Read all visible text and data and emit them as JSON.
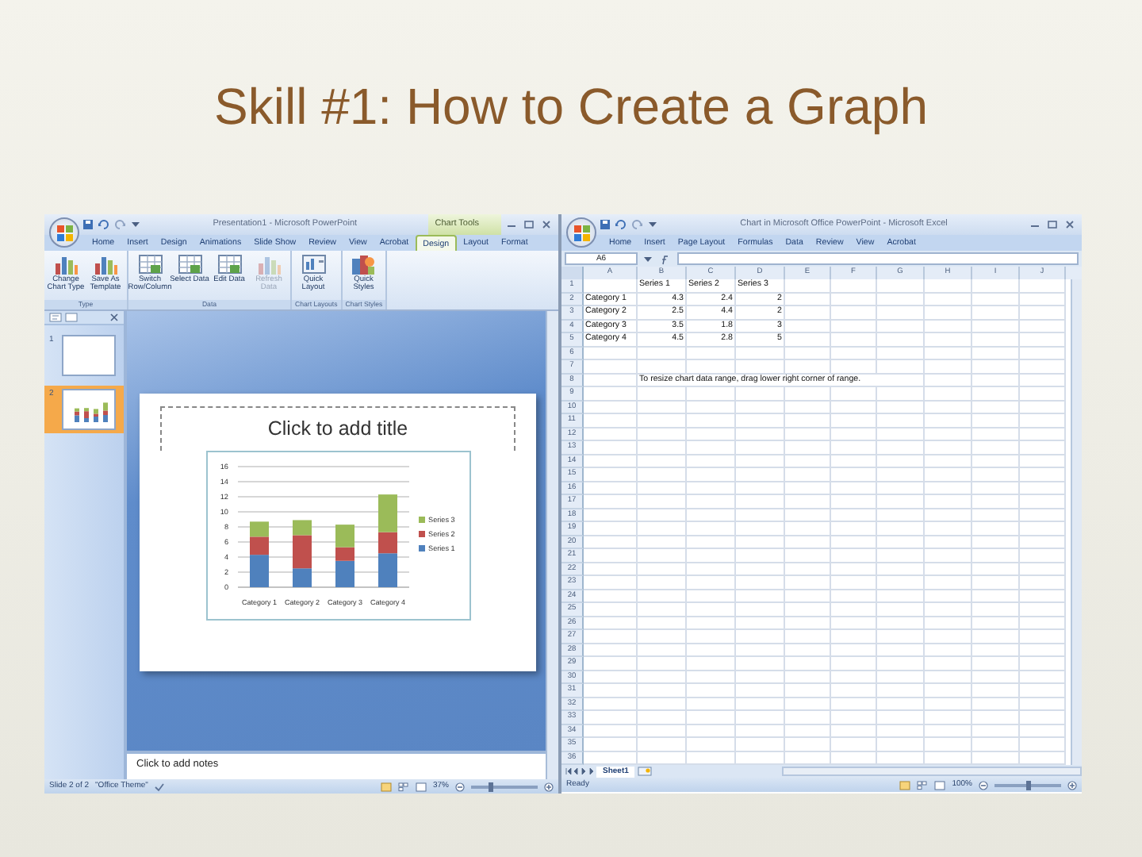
{
  "slide_title": "Skill #1: How to Create a Graph",
  "powerpoint": {
    "title": "Presentation1 - Microsoft PowerPoint",
    "contextual_tab": "Chart Tools",
    "tabs": [
      {
        "label": "Home",
        "selected": false
      },
      {
        "label": "Insert",
        "selected": false
      },
      {
        "label": "Design",
        "selected": false
      },
      {
        "label": "Animations",
        "selected": false
      },
      {
        "label": "Slide Show",
        "selected": false
      },
      {
        "label": "Review",
        "selected": false
      },
      {
        "label": "View",
        "selected": false
      },
      {
        "label": "Acrobat",
        "selected": false
      },
      {
        "label": "Design",
        "selected": true
      },
      {
        "label": "Layout",
        "selected": false
      },
      {
        "label": "Format",
        "selected": false
      }
    ],
    "ribbon_groups": [
      {
        "label": "Type",
        "buttons": [
          {
            "label": "Change Chart Type",
            "disabled": false
          },
          {
            "label": "Save As Template",
            "disabled": false
          }
        ]
      },
      {
        "label": "Data",
        "buttons": [
          {
            "label": "Switch Row/Column",
            "disabled": false
          },
          {
            "label": "Select Data",
            "disabled": false
          },
          {
            "label": "Edit Data",
            "disabled": false
          },
          {
            "label": "Refresh Data",
            "disabled": true
          }
        ]
      },
      {
        "label": "Chart Layouts",
        "buttons": [
          {
            "label": "Quick Layout",
            "disabled": false
          }
        ]
      },
      {
        "label": "Chart Styles",
        "buttons": [
          {
            "label": "Quick Styles",
            "disabled": false
          }
        ]
      }
    ],
    "slide_thumbnails": [
      {
        "number": "1",
        "kind": "blank",
        "selected": false
      },
      {
        "number": "2",
        "kind": "chart",
        "selected": true
      }
    ],
    "slide": {
      "title_placeholder": "Click to add title",
      "chart_data": {
        "type": "bar",
        "stacked": true,
        "grid": true,
        "legend": true,
        "orientation": "vertical",
        "categories": [
          "Category 1",
          "Category 2",
          "Category 3",
          "Category 4"
        ],
        "ylim": [
          0,
          16
        ],
        "yticks": [
          {
            "value": 0,
            "label": "0"
          },
          {
            "value": 2,
            "label": "2"
          },
          {
            "value": 4,
            "label": "4"
          },
          {
            "value": 6,
            "label": "6"
          },
          {
            "value": 8,
            "label": "8"
          },
          {
            "value": 10,
            "label": "10"
          },
          {
            "value": 12,
            "label": "12"
          },
          {
            "value": 14,
            "label": "14"
          },
          {
            "value": 16,
            "label": "16"
          }
        ],
        "series": [
          {
            "name": "Series 1",
            "color": "#4f81bd",
            "values": [
              4.3,
              2.5,
              3.5,
              4.5
            ]
          },
          {
            "name": "Series 2",
            "color": "#c0504d",
            "values": [
              2.4,
              4.4,
              1.8,
              2.8
            ]
          },
          {
            "name": "Series 3",
            "color": "#9bbb59",
            "values": [
              2,
              2,
              3,
              5
            ]
          }
        ]
      }
    },
    "notes_placeholder": "Click to add notes",
    "status_bar": {
      "slide_info": "Slide 2 of 2",
      "theme": "\"Office Theme\"",
      "zoom": "37%",
      "zoom_slider": {
        "level": 0.3
      }
    }
  },
  "excel": {
    "title": "Chart in Microsoft Office PowerPoint - Microsoft Excel",
    "tabs": [
      {
        "label": "Home",
        "selected": false
      },
      {
        "label": "Insert",
        "selected": false
      },
      {
        "label": "Page Layout",
        "selected": false
      },
      {
        "label": "Formulas",
        "selected": false
      },
      {
        "label": "Data",
        "selected": false
      },
      {
        "label": "Review",
        "selected": false
      },
      {
        "label": "View",
        "selected": false
      },
      {
        "label": "Acrobat",
        "selected": false
      }
    ],
    "name_box": "A6",
    "columns": [
      "A",
      "B",
      "C",
      "D",
      "E",
      "F",
      "G",
      "H",
      "I",
      "J"
    ],
    "rows": [
      {
        "number": "1",
        "cells": {
          "B": "Series 1",
          "C": "Series 2",
          "D": "Series 3"
        }
      },
      {
        "number": "2",
        "cells": {
          "A": "Category 1",
          "B": "4.3",
          "C": "2.4",
          "D": "2"
        }
      },
      {
        "number": "3",
        "cells": {
          "A": "Category 2",
          "B": "2.5",
          "C": "4.4",
          "D": "2"
        }
      },
      {
        "number": "4",
        "cells": {
          "A": "Category 3",
          "B": "3.5",
          "C": "1.8",
          "D": "3"
        }
      },
      {
        "number": "5",
        "cells": {
          "A": "Category 4",
          "B": "4.5",
          "C": "2.8",
          "D": "5"
        }
      },
      {
        "number": "6"
      },
      {
        "number": "7"
      },
      {
        "number": "8",
        "cells": {
          "B": "To resize chart data range, drag lower right corner of range."
        }
      },
      {
        "number": "9"
      },
      {
        "number": "10"
      },
      {
        "number": "11"
      },
      {
        "number": "12"
      },
      {
        "number": "13"
      },
      {
        "number": "14"
      },
      {
        "number": "15"
      },
      {
        "number": "16"
      },
      {
        "number": "17"
      },
      {
        "number": "18"
      },
      {
        "number": "19"
      },
      {
        "number": "20"
      },
      {
        "number": "21"
      },
      {
        "number": "22"
      },
      {
        "number": "23"
      },
      {
        "number": "24"
      },
      {
        "number": "25"
      },
      {
        "number": "26"
      },
      {
        "number": "27"
      },
      {
        "number": "28"
      },
      {
        "number": "29"
      },
      {
        "number": "30"
      },
      {
        "number": "31"
      },
      {
        "number": "32"
      },
      {
        "number": "33"
      },
      {
        "number": "34"
      },
      {
        "number": "35"
      },
      {
        "number": "36"
      }
    ],
    "sheet_tabs": [
      {
        "label": "Sheet1",
        "selected": true
      }
    ],
    "status_bar": {
      "status": "Ready",
      "zoom": "100%",
      "zoom_slider": {
        "level": 0.5
      }
    }
  }
}
